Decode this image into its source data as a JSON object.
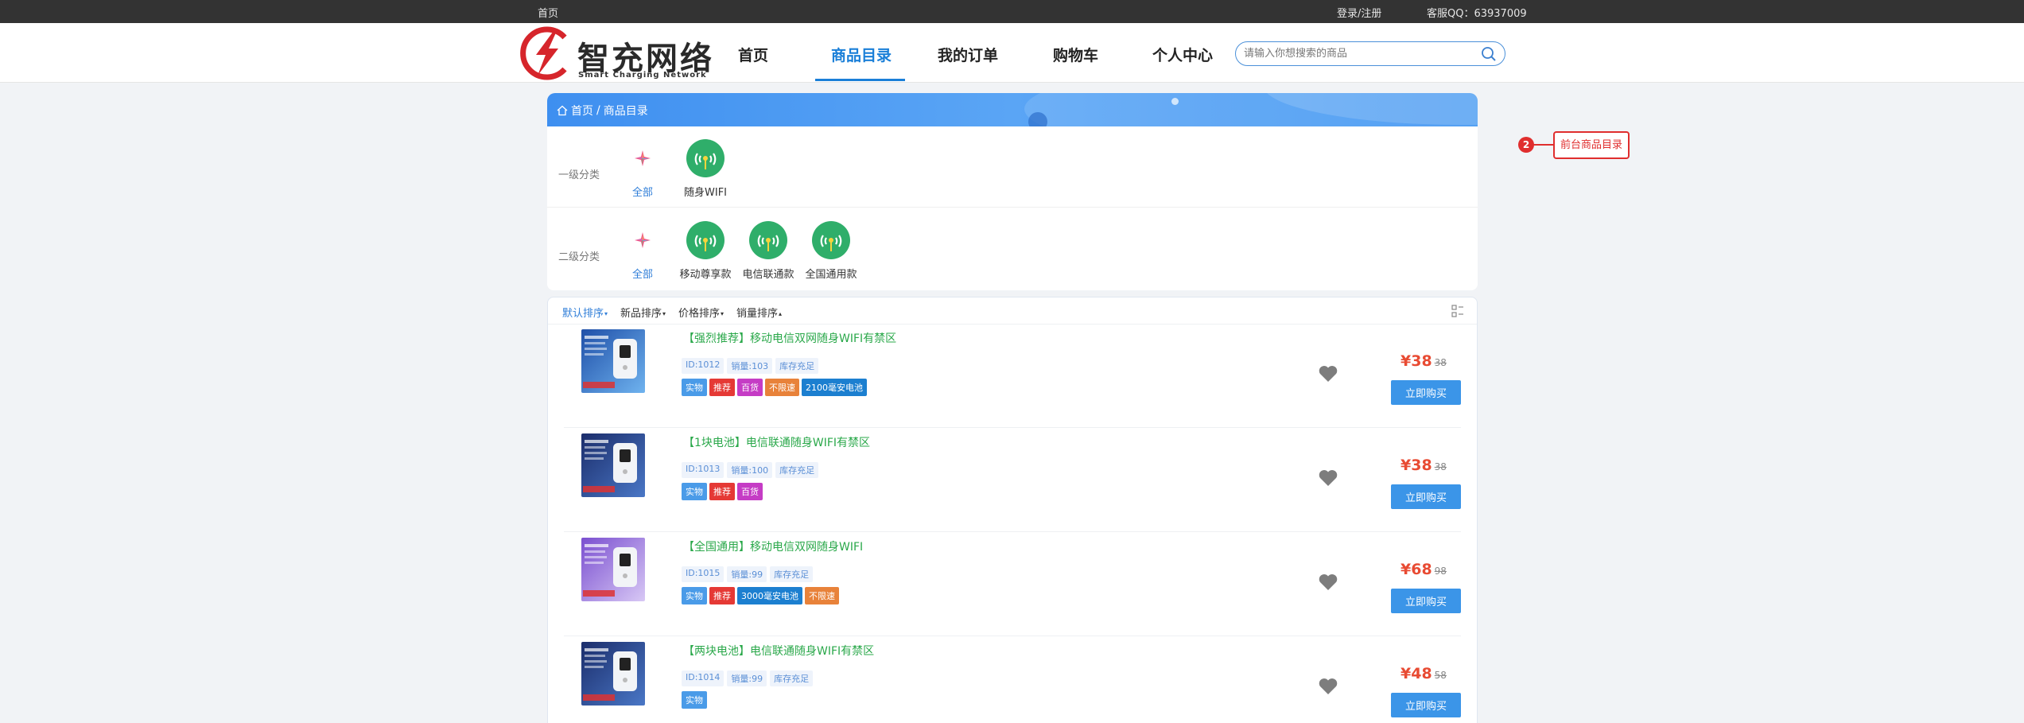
{
  "topbar": {
    "home": "首页",
    "login": "登录/注册",
    "qq": "客服QQ：63937009"
  },
  "logo": {
    "title": "智充网络",
    "subtitle": "Smart Charging Network"
  },
  "nav": {
    "items": [
      "首页",
      "商品目录",
      "我的订单",
      "购物车",
      "个人中心"
    ],
    "active": "商品目录"
  },
  "search": {
    "placeholder": "请输入你想搜索的商品"
  },
  "breadcrumb": {
    "home": "首页",
    "separator": "/",
    "current": "商品目录"
  },
  "categories": {
    "level1": {
      "label": "一级分类",
      "items": [
        "全部",
        "随身WIFI"
      ]
    },
    "level2": {
      "label": "二级分类",
      "items": [
        "全部",
        "移动尊享款",
        "电信联通款",
        "全国通用款"
      ]
    }
  },
  "sort": {
    "items": [
      "默认排序",
      "新品排序",
      "价格排序",
      "销量排序"
    ],
    "active": "默认排序"
  },
  "products": [
    {
      "title": "【强烈推荐】移动电信双网随身WIFI有禁区",
      "id": "ID:1012",
      "sales": "销量:103",
      "stock": "库存充足",
      "tags": [
        {
          "text": "实物",
          "color": "#4a9be8"
        },
        {
          "text": "推荐",
          "color": "#e53935"
        },
        {
          "text": "百货",
          "color": "#c53cc5"
        },
        {
          "text": "不限速",
          "color": "#e8823a"
        },
        {
          "text": "2100毫安电池",
          "color": "#1c7fd0"
        }
      ],
      "price": "¥38",
      "old_price": "38",
      "buy": "立即购买"
    },
    {
      "title": "【1块电池】电信联通随身WIFI有禁区",
      "id": "ID:1013",
      "sales": "销量:100",
      "stock": "库存充足",
      "tags": [
        {
          "text": "实物",
          "color": "#4a9be8"
        },
        {
          "text": "推荐",
          "color": "#e53935"
        },
        {
          "text": "百货",
          "color": "#c53cc5"
        }
      ],
      "price": "¥38",
      "old_price": "38",
      "buy": "立即购买"
    },
    {
      "title": "【全国通用】移动电信双网随身WIFI",
      "id": "ID:1015",
      "sales": "销量:99",
      "stock": "库存充足",
      "tags": [
        {
          "text": "实物",
          "color": "#4a9be8"
        },
        {
          "text": "推荐",
          "color": "#e53935"
        },
        {
          "text": "3000毫安电池",
          "color": "#1c7fd0"
        },
        {
          "text": "不限速",
          "color": "#e8823a"
        }
      ],
      "price": "¥68",
      "old_price": "98",
      "buy": "立即购买"
    },
    {
      "title": "【两块电池】电信联通随身WIFI有禁区",
      "id": "ID:1014",
      "sales": "销量:99",
      "stock": "库存充足",
      "tags": [
        {
          "text": "实物",
          "color": "#4a9be8"
        }
      ],
      "price": "¥48",
      "old_price": "58",
      "buy": "立即购买"
    }
  ],
  "annotation": {
    "number": "2",
    "label": "前台商品目录"
  },
  "colors": {
    "accent": "#1a7fd8",
    "price": "#e84b33",
    "title_green": "#2aa84a",
    "annotation": "#e02e2e"
  }
}
